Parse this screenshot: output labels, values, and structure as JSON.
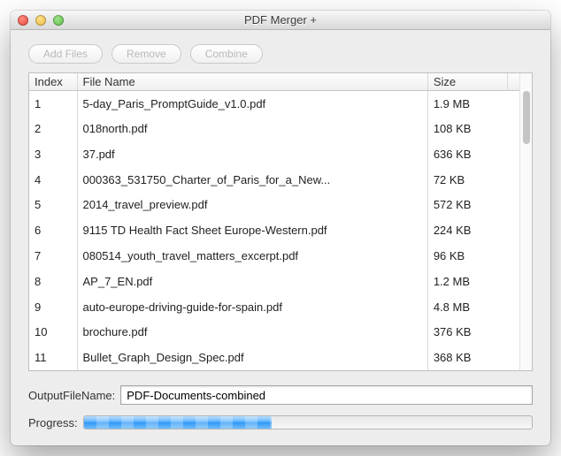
{
  "window": {
    "title": "PDF Merger +"
  },
  "toolbar": {
    "add_files": "Add Files",
    "remove": "Remove",
    "combine": "Combine"
  },
  "table": {
    "headers": {
      "index": "Index",
      "file_name": "File Name",
      "size": "Size"
    },
    "rows": [
      {
        "index": "1",
        "name": "5-day_Paris_PromptGuide_v1.0.pdf",
        "size": "1.9 MB"
      },
      {
        "index": "2",
        "name": "018north.pdf",
        "size": "108 KB"
      },
      {
        "index": "3",
        "name": "37.pdf",
        "size": "636 KB"
      },
      {
        "index": "4",
        "name": "000363_531750_Charter_of_Paris_for_a_New...",
        "size": "72 KB"
      },
      {
        "index": "5",
        "name": "2014_travel_preview.pdf",
        "size": "572 KB"
      },
      {
        "index": "6",
        "name": "9115 TD Health Fact Sheet Europe-Western.pdf",
        "size": "224 KB"
      },
      {
        "index": "7",
        "name": "080514_youth_travel_matters_excerpt.pdf",
        "size": "96 KB"
      },
      {
        "index": "8",
        "name": "AP_7_EN.pdf",
        "size": "1.2 MB"
      },
      {
        "index": "9",
        "name": "auto-europe-driving-guide-for-spain.pdf",
        "size": "4.8 MB"
      },
      {
        "index": "10",
        "name": "brochure.pdf",
        "size": "376 KB"
      },
      {
        "index": "11",
        "name": "Bullet_Graph_Design_Spec.pdf",
        "size": "368 KB"
      }
    ]
  },
  "output": {
    "label": "OutputFileName:",
    "value": "PDF-Documents-combined"
  },
  "progress": {
    "label": "Progress:",
    "percent": 42
  }
}
